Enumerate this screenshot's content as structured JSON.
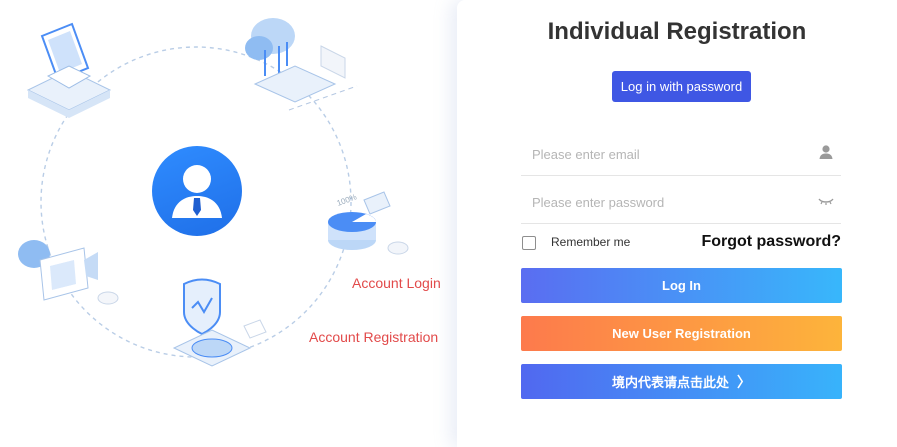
{
  "annotations": {
    "account_login": "Account Login",
    "account_registration": "Account Registration"
  },
  "panel": {
    "title": "Individual Registration",
    "password_tab": "Log in with password",
    "email_placeholder": "Please enter email",
    "password_placeholder": "Please enter password",
    "remember_me": "Remember me",
    "forgot_password": "Forgot password?",
    "login_button": "Log In",
    "register_button": "New User Registration",
    "representative_button": "境内代表请点击此处",
    "representative_chevron": "〉"
  },
  "icons": {
    "email_field_icon": "user-icon",
    "password_field_icon": "eye-closed-icon"
  },
  "colors": {
    "primary_tab": "#3f57e4",
    "annotation_red": "#e24a4a",
    "login_gradient": [
      "#5a6df1",
      "#38b7fb"
    ],
    "register_gradient": [
      "#fd7a4c",
      "#fdb43b"
    ]
  }
}
